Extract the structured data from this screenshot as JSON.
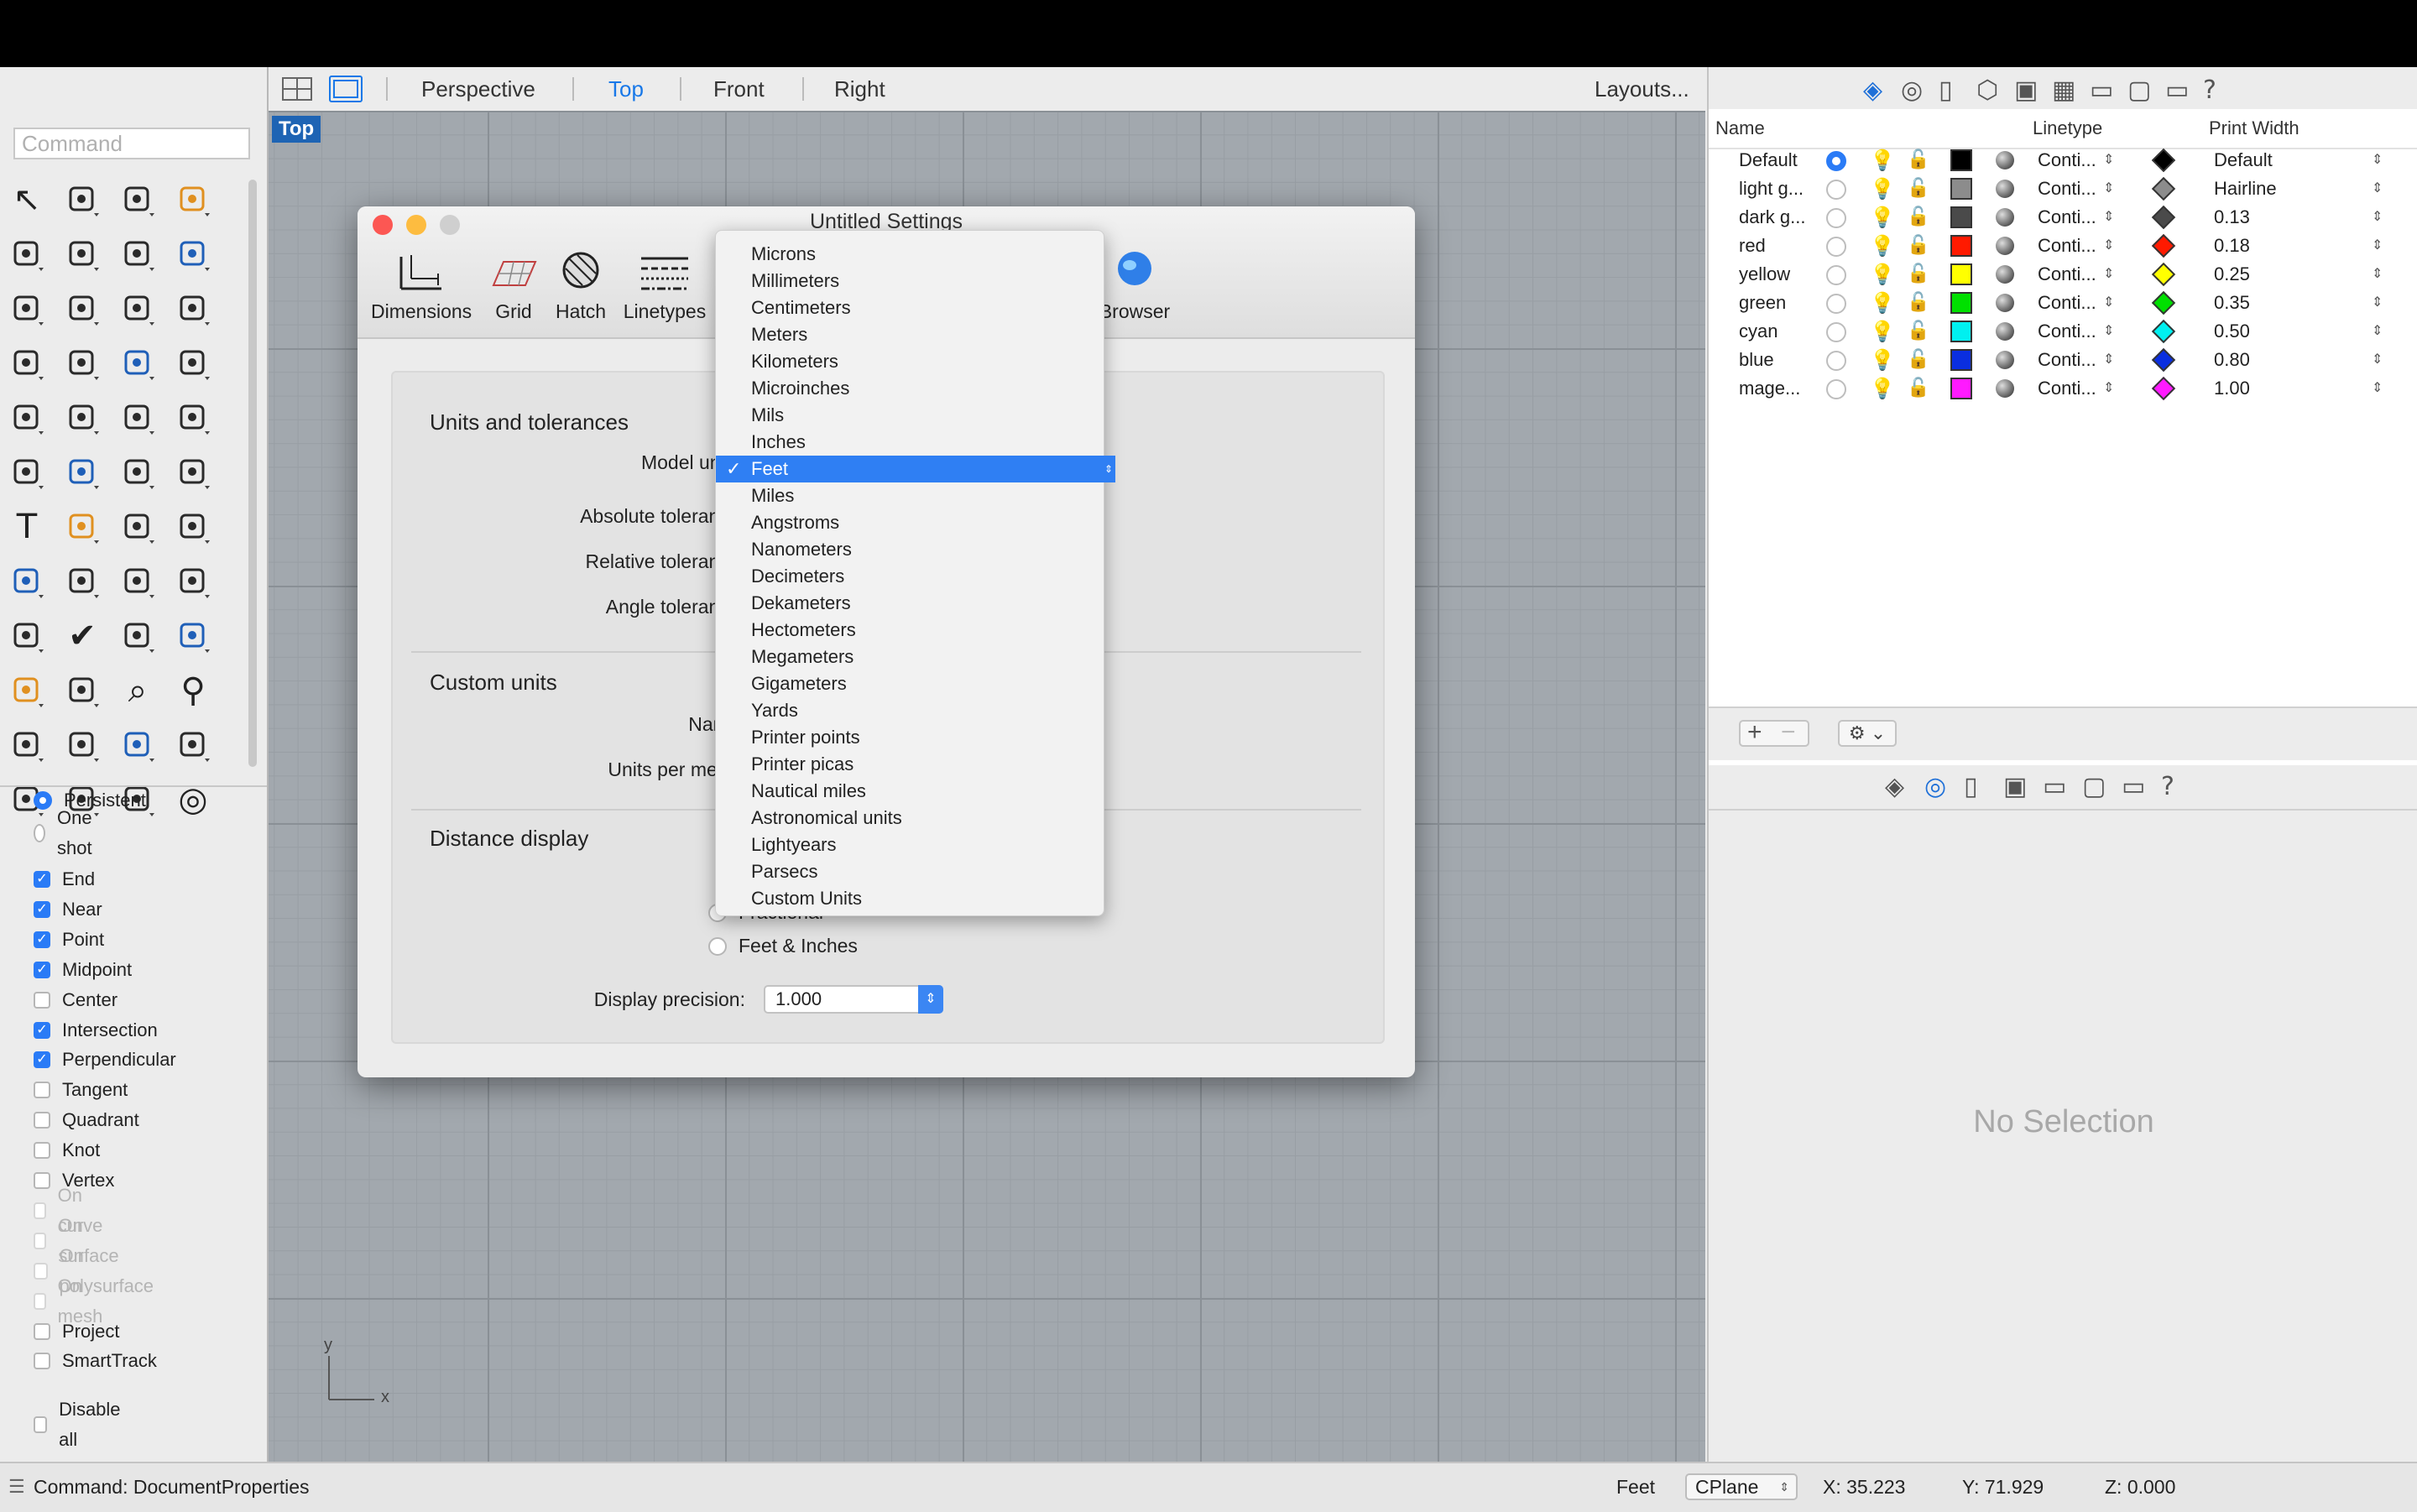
{
  "command_placeholder": "Command",
  "viewport_tabs": [
    "Perspective",
    "Top",
    "Front",
    "Right"
  ],
  "active_tab": "Top",
  "layouts_label": "Layouts...",
  "viewport_label": "Top",
  "snap_modes": [
    {
      "label": "Persistent",
      "type": "radio",
      "checked": true
    },
    {
      "label": "One shot",
      "type": "radio",
      "checked": false
    }
  ],
  "osnaps": [
    {
      "label": "End",
      "checked": true,
      "disabled": false
    },
    {
      "label": "Near",
      "checked": true,
      "disabled": false
    },
    {
      "label": "Point",
      "checked": true,
      "disabled": false
    },
    {
      "label": "Midpoint",
      "checked": true,
      "disabled": false
    },
    {
      "label": "Center",
      "checked": false,
      "disabled": false
    },
    {
      "label": "Intersection",
      "checked": true,
      "disabled": false
    },
    {
      "label": "Perpendicular",
      "checked": true,
      "disabled": false
    },
    {
      "label": "Tangent",
      "checked": false,
      "disabled": false
    },
    {
      "label": "Quadrant",
      "checked": false,
      "disabled": false
    },
    {
      "label": "Knot",
      "checked": false,
      "disabled": false
    },
    {
      "label": "Vertex",
      "checked": false,
      "disabled": false
    },
    {
      "label": "On curve",
      "checked": false,
      "disabled": true
    },
    {
      "label": "On surface",
      "checked": false,
      "disabled": true
    },
    {
      "label": "On polysurface",
      "checked": false,
      "disabled": true
    },
    {
      "label": "On mesh",
      "checked": false,
      "disabled": true
    },
    {
      "label": "Project",
      "checked": false,
      "disabled": false
    },
    {
      "label": "SmartTrack",
      "checked": false,
      "disabled": false
    }
  ],
  "disable_all": "Disable all",
  "layers_header": {
    "name": "Name",
    "linetype": "Linetype",
    "print_width": "Print Width"
  },
  "layers": [
    {
      "name": "Default",
      "color": "#000000",
      "linetype": "Conti...",
      "print_width": "Default",
      "current": true
    },
    {
      "name": "light g...",
      "color": "#8c8c8c",
      "linetype": "Conti...",
      "print_width": "Hairline",
      "current": false
    },
    {
      "name": "dark g...",
      "color": "#4a4a4a",
      "linetype": "Conti...",
      "print_width": "0.13",
      "current": false
    },
    {
      "name": "red",
      "color": "#ff1a00",
      "linetype": "Conti...",
      "print_width": "0.18",
      "current": false
    },
    {
      "name": "yellow",
      "color": "#ffff00",
      "linetype": "Conti...",
      "print_width": "0.25",
      "current": false
    },
    {
      "name": "green",
      "color": "#00e000",
      "linetype": "Conti...",
      "print_width": "0.35",
      "current": false
    },
    {
      "name": "cyan",
      "color": "#00f0f0",
      "linetype": "Conti...",
      "print_width": "0.50",
      "current": false
    },
    {
      "name": "blue",
      "color": "#0a2ee0",
      "linetype": "Conti...",
      "print_width": "0.80",
      "current": false
    },
    {
      "name": "mage...",
      "color": "#ff1aff",
      "linetype": "Conti...",
      "print_width": "1.00",
      "current": false
    }
  ],
  "no_selection": "No Selection",
  "dialog": {
    "title": "Untitled Settings",
    "tabs": [
      "Dimensions",
      "Grid",
      "Hatch",
      "Linetypes",
      "Browser"
    ],
    "sections": {
      "units": "Units and tolerances",
      "custom": "Custom units",
      "distance": "Distance display"
    },
    "labels": {
      "model_units": "Model units:",
      "abs_tol": "Absolute tolerance:",
      "rel_tol": "Relative tolerance:",
      "angle_tol": "Angle tolerance:",
      "name": "Name:",
      "units_per_meter": "Units per meter:",
      "display_precision": "Display precision:"
    },
    "distance_options": [
      "Fractional",
      "Feet & Inches"
    ],
    "display_precision": "1.000"
  },
  "unit_options": [
    "Microns",
    "Millimeters",
    "Centimeters",
    "Meters",
    "Kilometers",
    "Microinches",
    "Mils",
    "Inches",
    "Feet",
    "Miles",
    "Angstroms",
    "Nanometers",
    "Decimeters",
    "Dekameters",
    "Hectometers",
    "Megameters",
    "Gigameters",
    "Yards",
    "Printer points",
    "Printer picas",
    "Nautical miles",
    "Astronomical units",
    "Lightyears",
    "Parsecs",
    "Custom Units"
  ],
  "selected_unit": "Feet",
  "status": {
    "command": "Command: DocumentProperties",
    "units": "Feet",
    "cplane": "CPlane",
    "x": "X: 35.223",
    "y": "Y: 71.929",
    "z": "Z: 0.000"
  },
  "axis": {
    "x": "x",
    "y": "y"
  }
}
